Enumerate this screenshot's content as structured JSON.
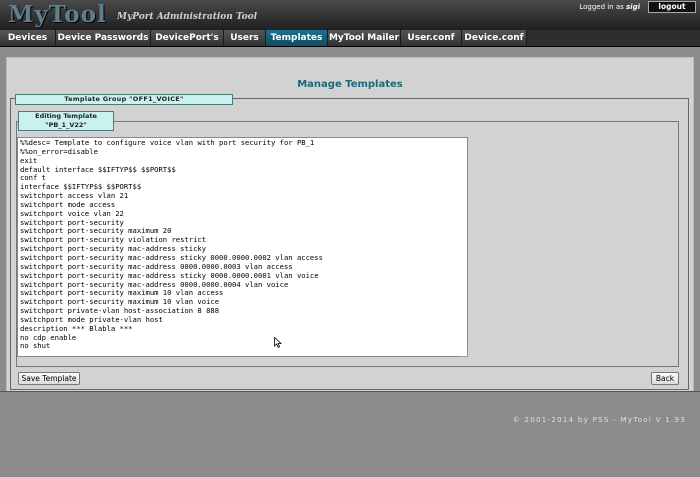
{
  "header": {
    "logo": "MyTool",
    "subtitle": "MyPort Administration Tool",
    "logged_prefix": "Logged in as ",
    "user": "sigi",
    "logout": "logout"
  },
  "nav": {
    "tabs": [
      {
        "label": "Devices"
      },
      {
        "label": "Device Passwords"
      },
      {
        "label": "DevicePort's"
      },
      {
        "label": "Users"
      },
      {
        "label": "Templates",
        "active": true
      },
      {
        "label": "MyTool Mailer"
      },
      {
        "label": "User.conf"
      },
      {
        "label": "Device.conf"
      }
    ]
  },
  "page": {
    "title": "Manage Templates",
    "group_label": "Template Group \"OFF1_VOICE\"",
    "edit_label_line1": "Editing Template",
    "edit_label_line2": "\"PB_1_V22\"",
    "template_text": "%%desc= Template to configure voice vlan with port security for PB_1\n%%on_error=disable\nexit\ndefault interface $$IFTYP$$ $$PORT$$\nconf t\ninterface $$IFTYP$$ $$PORT$$\nswitchport access vlan 21\nswitchport mode access\nswitchport voice vlan 22\nswitchport port-security\nswitchport port-security maximum 20\nswitchport port-security violation restrict\nswitchport port-security mac-address sticky\nswitchport port-security mac-address sticky 0000.0000.0002 vlan access\nswitchport port-security mac-address 0000.0000.0003 vlan access\nswitchport port-security mac-address sticky 0000.0000.0001 vlan voice\nswitchport port-security mac-address 0000.0000.0004 vlan voice\nswitchport port-security maximum 10 vlan access\nswitchport port-security maximum 10 vlan voice\nswitchport private-vlan host-association 8 888\nswitchport mode private-vlan host\ndescription *** Blabla ***\nno cdp enable\nno shut",
    "save_button": "Save Template",
    "back_button": "Back"
  },
  "footer": {
    "copyright": "© 2001-2014 by PSS - MyTool V 1.93"
  }
}
